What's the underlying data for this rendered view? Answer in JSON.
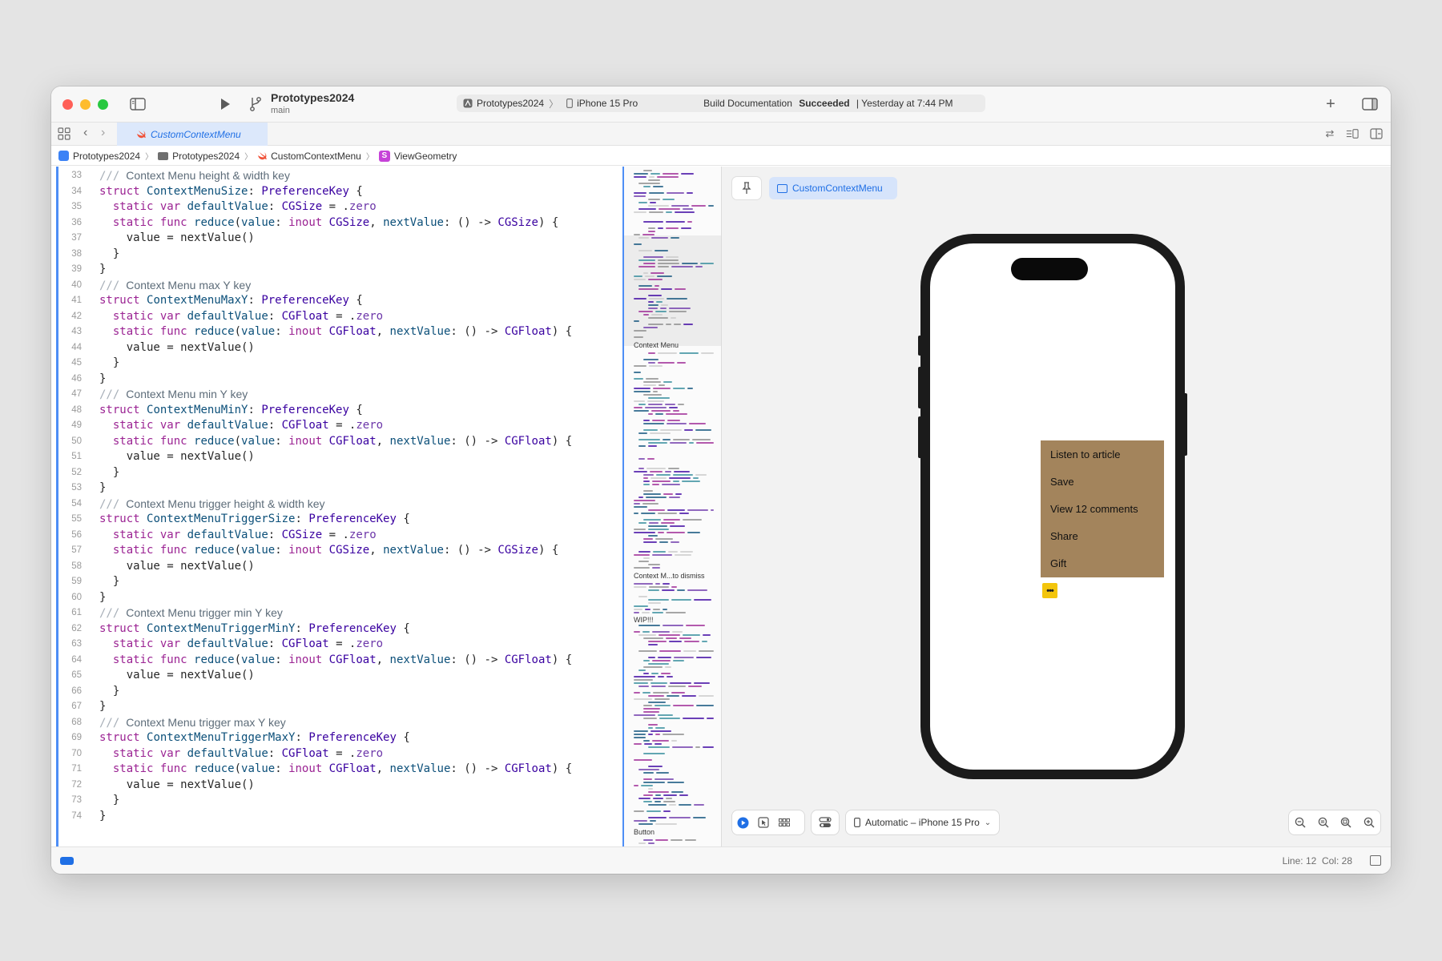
{
  "titlebar": {
    "project_name": "Prototypes2024",
    "branch": "main",
    "activity": {
      "scheme": "Prototypes2024",
      "device": "iPhone 15 Pro",
      "status_prefix": "Build Documentation ",
      "status_strong": "Succeeded",
      "status_suffix": " | Yesterday at 7:44 PM"
    },
    "add_symbol": "+"
  },
  "tabbar": {
    "active_tab": "CustomContextMenu"
  },
  "breadcrumb": {
    "items": [
      "Prototypes2024",
      "Prototypes2024",
      "CustomContextMenu",
      "ViewGeometry"
    ],
    "s_badge": "S"
  },
  "editor": {
    "lines": [
      {
        "n": "33",
        "html": "<span class=\"slashes\">///</span>Context Menu height &amp; width key",
        "comment": true
      },
      {
        "n": "34",
        "html": "<span class=\"kw\">struct</span> <span class=\"dt\">ContextMenuSize</span>: <span class=\"ty\">PreferenceKey</span> {"
      },
      {
        "n": "35",
        "html": "  <span class=\"kw\">static</span> <span class=\"kw\">var</span> <span class=\"dt\">defaultValue</span>: <span class=\"ty\">CGSize</span> = .<span class=\"pr\">zero</span>"
      },
      {
        "n": "36",
        "html": "  <span class=\"kw\">static</span> <span class=\"kw\">func</span> <span class=\"dt\">reduce</span>(<span class=\"dt\">value</span>: <span class=\"kw\">inout</span> <span class=\"ty\">CGSize</span>, <span class=\"dt\">nextValue</span>: () -&gt; <span class=\"ty\">CGSize</span>) {"
      },
      {
        "n": "37",
        "html": "    value = nextValue()"
      },
      {
        "n": "38",
        "html": "  }"
      },
      {
        "n": "39",
        "html": "}"
      },
      {
        "n": "40",
        "html": "<span class=\"slashes\">///</span>Context Menu max Y key",
        "comment": true
      },
      {
        "n": "41",
        "html": "<span class=\"kw\">struct</span> <span class=\"dt\">ContextMenuMaxY</span>: <span class=\"ty\">PreferenceKey</span> {"
      },
      {
        "n": "42",
        "html": "  <span class=\"kw\">static</span> <span class=\"kw\">var</span> <span class=\"dt\">defaultValue</span>: <span class=\"ty\">CGFloat</span> = .<span class=\"pr\">zero</span>"
      },
      {
        "n": "43",
        "html": "  <span class=\"kw\">static</span> <span class=\"kw\">func</span> <span class=\"dt\">reduce</span>(<span class=\"dt\">value</span>: <span class=\"kw\">inout</span> <span class=\"ty\">CGFloat</span>, <span class=\"dt\">nextValue</span>: () -&gt; <span class=\"ty\">CGFloat</span>) {"
      },
      {
        "n": "44",
        "html": "    value = nextValue()"
      },
      {
        "n": "45",
        "html": "  }"
      },
      {
        "n": "46",
        "html": "}"
      },
      {
        "n": "47",
        "html": "<span class=\"slashes\">///</span>Context Menu min Y key",
        "comment": true
      },
      {
        "n": "48",
        "html": "<span class=\"kw\">struct</span> <span class=\"dt\">ContextMenuMinY</span>: <span class=\"ty\">PreferenceKey</span> {"
      },
      {
        "n": "49",
        "html": "  <span class=\"kw\">static</span> <span class=\"kw\">var</span> <span class=\"dt\">defaultValue</span>: <span class=\"ty\">CGFloat</span> = .<span class=\"pr\">zero</span>"
      },
      {
        "n": "50",
        "html": "  <span class=\"kw\">static</span> <span class=\"kw\">func</span> <span class=\"dt\">reduce</span>(<span class=\"dt\">value</span>: <span class=\"kw\">inout</span> <span class=\"ty\">CGFloat</span>, <span class=\"dt\">nextValue</span>: () -&gt; <span class=\"ty\">CGFloat</span>) {"
      },
      {
        "n": "51",
        "html": "    value = nextValue()"
      },
      {
        "n": "52",
        "html": "  }"
      },
      {
        "n": "53",
        "html": "}"
      },
      {
        "n": "54",
        "html": "<span class=\"slashes\">///</span>Context Menu trigger height &amp; width key",
        "comment": true
      },
      {
        "n": "55",
        "html": "<span class=\"kw\">struct</span> <span class=\"dt\">ContextMenuTriggerSize</span>: <span class=\"ty\">PreferenceKey</span> {"
      },
      {
        "n": "56",
        "html": "  <span class=\"kw\">static</span> <span class=\"kw\">var</span> <span class=\"dt\">defaultValue</span>: <span class=\"ty\">CGSize</span> = .<span class=\"pr\">zero</span>"
      },
      {
        "n": "57",
        "html": "  <span class=\"kw\">static</span> <span class=\"kw\">func</span> <span class=\"dt\">reduce</span>(<span class=\"dt\">value</span>: <span class=\"kw\">inout</span> <span class=\"ty\">CGSize</span>, <span class=\"dt\">nextValue</span>: () -&gt; <span class=\"ty\">CGSize</span>) {"
      },
      {
        "n": "58",
        "html": "    value = nextValue()"
      },
      {
        "n": "59",
        "html": "  }"
      },
      {
        "n": "60",
        "html": "}"
      },
      {
        "n": "61",
        "html": "<span class=\"slashes\">///</span>Context Menu trigger min Y key",
        "comment": true
      },
      {
        "n": "62",
        "html": "<span class=\"kw\">struct</span> <span class=\"dt\">ContextMenuTriggerMinY</span>: <span class=\"ty\">PreferenceKey</span> {"
      },
      {
        "n": "63",
        "html": "  <span class=\"kw\">static</span> <span class=\"kw\">var</span> <span class=\"dt\">defaultValue</span>: <span class=\"ty\">CGFloat</span> = .<span class=\"pr\">zero</span>"
      },
      {
        "n": "64",
        "html": "  <span class=\"kw\">static</span> <span class=\"kw\">func</span> <span class=\"dt\">reduce</span>(<span class=\"dt\">value</span>: <span class=\"kw\">inout</span> <span class=\"ty\">CGFloat</span>, <span class=\"dt\">nextValue</span>: () -&gt; <span class=\"ty\">CGFloat</span>) {"
      },
      {
        "n": "65",
        "html": "    value = nextValue()"
      },
      {
        "n": "66",
        "html": "  }"
      },
      {
        "n": "67",
        "html": "}"
      },
      {
        "n": "68",
        "html": "<span class=\"slashes\">///</span>Context Menu trigger max Y key",
        "comment": true
      },
      {
        "n": "69",
        "html": "<span class=\"kw\">struct</span> <span class=\"dt\">ContextMenuTriggerMaxY</span>: <span class=\"ty\">PreferenceKey</span> {"
      },
      {
        "n": "70",
        "html": "  <span class=\"kw\">static</span> <span class=\"kw\">var</span> <span class=\"dt\">defaultValue</span>: <span class=\"ty\">CGFloat</span> = .<span class=\"pr\">zero</span>"
      },
      {
        "n": "71",
        "html": "  <span class=\"kw\">static</span> <span class=\"kw\">func</span> <span class=\"dt\">reduce</span>(<span class=\"dt\">value</span>: <span class=\"kw\">inout</span> <span class=\"ty\">CGFloat</span>, <span class=\"dt\">nextValue</span>: () -&gt; <span class=\"ty\">CGFloat</span>) {"
      },
      {
        "n": "72",
        "html": "    value = nextValue()"
      },
      {
        "n": "73",
        "html": "  }"
      },
      {
        "n": "74",
        "html": "}"
      }
    ]
  },
  "minimap": {
    "labels": [
      "Context Menu",
      "Context M...to dismiss",
      "WIP!!!",
      "Button"
    ]
  },
  "preview": {
    "chip_label": "CustomContextMenu",
    "context_menu_items": [
      "Listen to article",
      "Save",
      "View 12 comments",
      "Share",
      "Gift"
    ],
    "trigger_label": "•••",
    "device_picker": "Automatic – iPhone 15 Pro",
    "colors": {
      "menu_background": "#a3845c",
      "trigger_background": "#f3c50c",
      "accent": "#1f6fe5"
    }
  },
  "statusbar": {
    "cursor_position": "Line: 12  Col: 28"
  }
}
